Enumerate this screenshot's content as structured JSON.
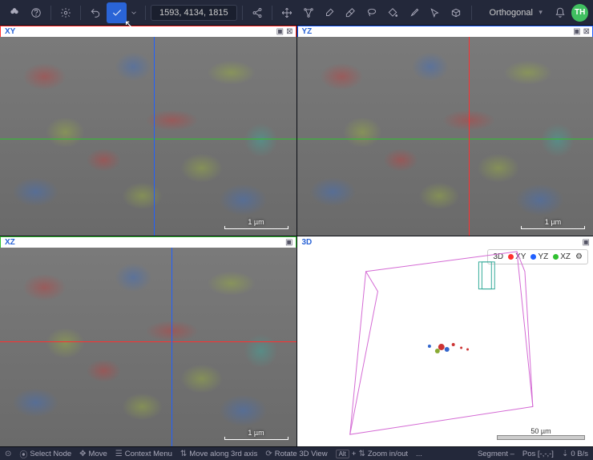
{
  "toolbar": {
    "coords": "1593, 4134, 1815",
    "projection": "Orthogonal",
    "avatar": "TH"
  },
  "panes": {
    "xy": {
      "label": "XY",
      "scale": "1 µm"
    },
    "yz": {
      "label": "YZ",
      "scale": "1 µm"
    },
    "xz": {
      "label": "XZ",
      "scale": "1 µm"
    },
    "td": {
      "label": "3D",
      "scale": "50 µm"
    }
  },
  "legend3d": {
    "td": "3D",
    "xy": "XY",
    "yz": "YZ",
    "xz": "XZ",
    "colors": {
      "xy": "#ff3030",
      "yz": "#2060ff",
      "xz": "#30c030"
    }
  },
  "status": {
    "select_node": "Select Node",
    "move": "Move",
    "context_menu": "Context Menu",
    "move_axis": "Move along 3rd axis",
    "rotate_3d": "Rotate 3D View",
    "alt": "Alt",
    "zoom": "Zoom in/out",
    "more": "...",
    "segment": "Segment –",
    "pos": "Pos [-,-,-]",
    "rate": "0 B/s"
  }
}
